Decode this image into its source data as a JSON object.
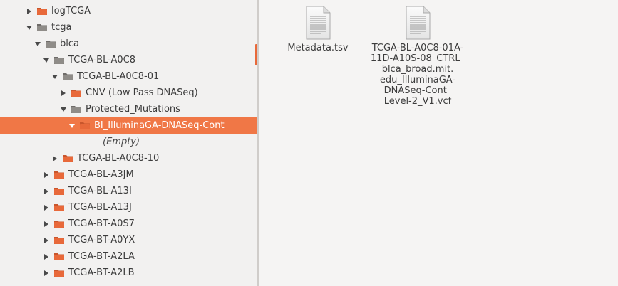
{
  "colors": {
    "accent": "#f07746",
    "folder_orange": "#e8693a",
    "folder_gray": "#8f8c88",
    "selected_text": "#ffffff"
  },
  "tree": {
    "rows": [
      {
        "label": "logTCGA",
        "depth": 0,
        "expander": "collapsed",
        "folder": "orange-folder-icon"
      },
      {
        "label": "tcga",
        "depth": 0,
        "expander": "expanded",
        "folder": "gray-folder-icon"
      },
      {
        "label": "blca",
        "depth": 1,
        "expander": "expanded",
        "folder": "gray-folder-icon"
      },
      {
        "label": "TCGA-BL-A0C8",
        "depth": 2,
        "expander": "expanded",
        "folder": "gray-folder-icon"
      },
      {
        "label": "TCGA-BL-A0C8-01",
        "depth": 3,
        "expander": "expanded",
        "folder": "gray-folder-icon"
      },
      {
        "label": "CNV (Low Pass DNASeq)",
        "depth": 4,
        "expander": "collapsed",
        "folder": "orange-folder-icon"
      },
      {
        "label": "Protected_Mutations",
        "depth": 4,
        "expander": "expanded",
        "folder": "gray-folder-icon"
      },
      {
        "label": "BI_IlluminaGA-DNASeq-Cont",
        "depth": 5,
        "expander": "expanded",
        "folder": "orange-folder-icon",
        "selected": true
      },
      {
        "label": "(Empty)",
        "depth": 6,
        "expander": "none",
        "folder": "none",
        "empty": true
      },
      {
        "label": "TCGA-BL-A0C8-10",
        "depth": 3,
        "expander": "collapsed",
        "folder": "orange-folder-icon"
      },
      {
        "label": "TCGA-BL-A3JM",
        "depth": 2,
        "expander": "collapsed",
        "folder": "orange-folder-icon"
      },
      {
        "label": "TCGA-BL-A13I",
        "depth": 2,
        "expander": "collapsed",
        "folder": "orange-folder-icon"
      },
      {
        "label": "TCGA-BL-A13J",
        "depth": 2,
        "expander": "collapsed",
        "folder": "orange-folder-icon"
      },
      {
        "label": "TCGA-BT-A0S7",
        "depth": 2,
        "expander": "collapsed",
        "folder": "orange-folder-icon"
      },
      {
        "label": "TCGA-BT-A0YX",
        "depth": 2,
        "expander": "collapsed",
        "folder": "orange-folder-icon"
      },
      {
        "label": "TCGA-BT-A2LA",
        "depth": 2,
        "expander": "collapsed",
        "folder": "orange-folder-icon"
      },
      {
        "label": "TCGA-BT-A2LB",
        "depth": 2,
        "expander": "collapsed",
        "folder": "orange-folder-icon"
      }
    ]
  },
  "files": [
    {
      "name": "Metadata.tsv",
      "icon": "text-document-icon"
    },
    {
      "name": "TCGA-BL-A0C8-01A-\n11D-A10S-08_CTRL_\nblca_broad.mit.\nedu_IlluminaGA-\nDNASeq-Cont_\nLevel-2_V1.vcf",
      "icon": "text-document-icon"
    }
  ]
}
